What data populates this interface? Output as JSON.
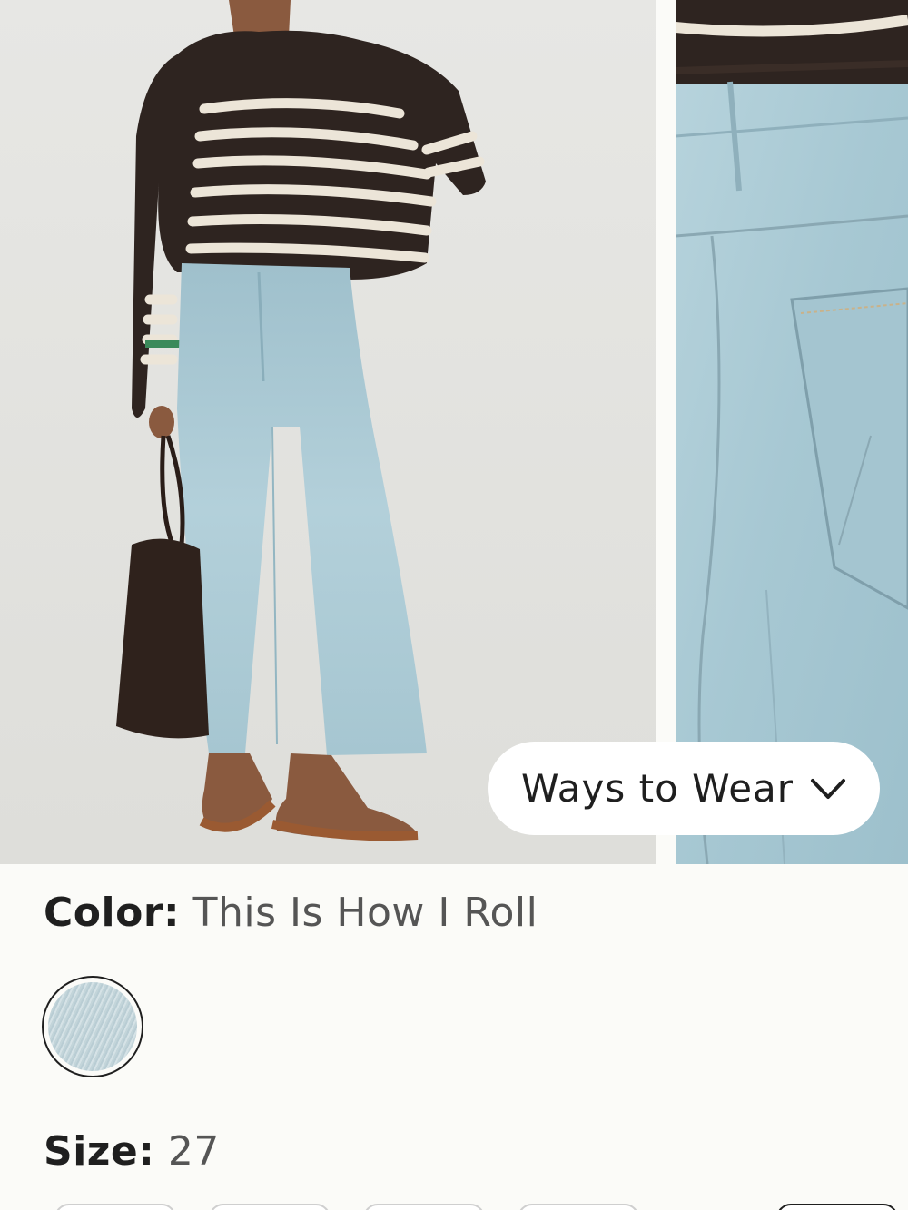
{
  "gallery": {
    "ways_to_wear_label": "Ways to Wear",
    "chevron_icon": "chevron-down-icon"
  },
  "product": {
    "color_key": "Color:",
    "color_value": "This Is How I Roll",
    "size_key": "Size:",
    "size_value": "27"
  },
  "colors": {
    "background": "#fbfbf8",
    "denim": "#a9c9d4",
    "sweater": "#2e2420",
    "stripe": "#ece5d8"
  }
}
